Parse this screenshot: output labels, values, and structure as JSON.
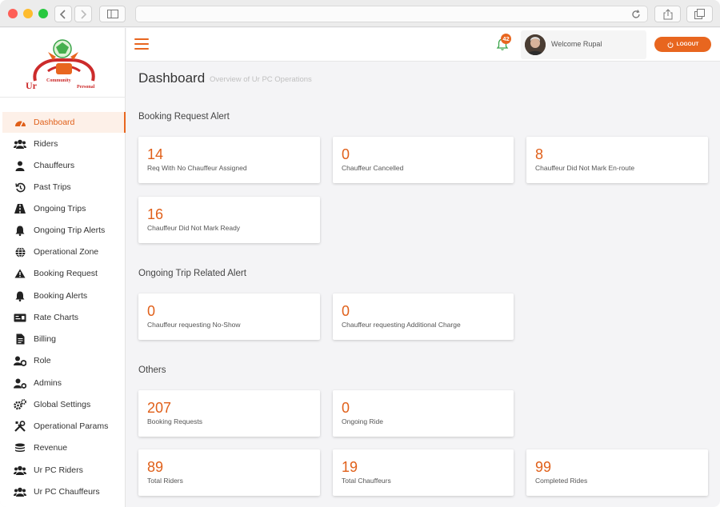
{
  "app": {
    "title": "Dashboard",
    "subtitle": "Overview of Ur PC Operations",
    "logo": {
      "text_top": "Community",
      "text_left": "Ur",
      "text_right": "Personal"
    }
  },
  "colors": {
    "accent": "#e8661f",
    "sidebar_active_bg": "#fdf0e8"
  },
  "sidebar": {
    "items": [
      {
        "label": "Dashboard",
        "icon": "dashboard-icon",
        "active": true
      },
      {
        "label": "Riders",
        "icon": "users-icon"
      },
      {
        "label": "Chauffeurs",
        "icon": "user-icon"
      },
      {
        "label": "Past Trips",
        "icon": "history-icon"
      },
      {
        "label": "Ongoing Trips",
        "icon": "road-icon"
      },
      {
        "label": "Ongoing Trip Alerts",
        "icon": "bell-icon"
      },
      {
        "label": "Operational Zone",
        "icon": "globe-icon"
      },
      {
        "label": "Booking Request",
        "icon": "warning-icon"
      },
      {
        "label": "Booking Alerts",
        "icon": "bell-icon"
      },
      {
        "label": "Rate Charts",
        "icon": "money-icon"
      },
      {
        "label": "Billing",
        "icon": "file-icon"
      },
      {
        "label": "Role",
        "icon": "users-cog-icon"
      },
      {
        "label": "Admins",
        "icon": "user-cog-icon"
      },
      {
        "label": "Global Settings",
        "icon": "cogs-icon"
      },
      {
        "label": "Operational Params",
        "icon": "tools-icon"
      },
      {
        "label": "Revenue",
        "icon": "coins-icon"
      },
      {
        "label": "Ur PC Riders",
        "icon": "users-icon"
      },
      {
        "label": "Ur PC Chauffeurs",
        "icon": "users-icon"
      }
    ]
  },
  "header": {
    "notification_count": "42",
    "welcome": "Welcome Rupal",
    "logout_label": "LOGOUT"
  },
  "sections": {
    "booking": {
      "title": "Booking Request Alert",
      "cards": [
        {
          "value": "14",
          "label": "Req With No Chauffeur Assigned"
        },
        {
          "value": "0",
          "label": "Chauffeur Cancelled"
        },
        {
          "value": "8",
          "label": "Chauffeur Did Not Mark En-route"
        },
        {
          "value": "16",
          "label": "Chauffeur Did Not Mark Ready"
        }
      ]
    },
    "ongoing": {
      "title": "Ongoing Trip Related Alert",
      "cards": [
        {
          "value": "0",
          "label": "Chauffeur requesting No-Show"
        },
        {
          "value": "0",
          "label": "Chauffeur requesting Additional Charge"
        }
      ]
    },
    "others": {
      "title": "Others",
      "cards": [
        {
          "value": "207",
          "label": "Booking Requests"
        },
        {
          "value": "0",
          "label": "Ongoing Ride"
        },
        {
          "value": "89",
          "label": "Total Riders"
        },
        {
          "value": "19",
          "label": "Total Chauffeurs"
        },
        {
          "value": "99",
          "label": "Completed Rides"
        }
      ]
    }
  }
}
